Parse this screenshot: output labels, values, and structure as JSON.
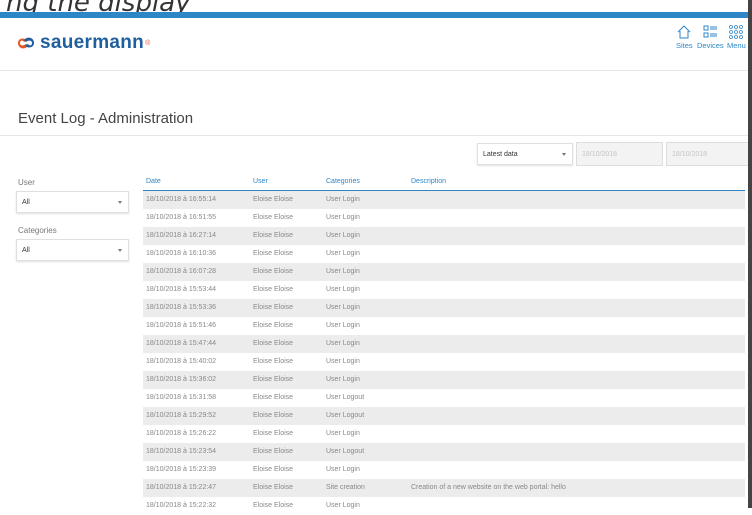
{
  "top_caption": "ng the display",
  "brand": {
    "name": "sauermann",
    "reg": "®",
    "color": "#1f5f9e",
    "accent": "#e1592b"
  },
  "nav": [
    {
      "label": "Sites",
      "icon": "home-icon"
    },
    {
      "label": "Devices",
      "icon": "list-icon"
    },
    {
      "label": "Menu",
      "icon": "grid-icon"
    }
  ],
  "page_title": "Event Log - Administration",
  "filters": {
    "period": {
      "value": "Latest data"
    },
    "date_from": {
      "value": "18/10/2018"
    },
    "date_to": {
      "value": "18/10/2018"
    },
    "user": {
      "label": "User",
      "value": "All"
    },
    "categories": {
      "label": "Categories",
      "value": "All"
    }
  },
  "table": {
    "columns": [
      "Date",
      "User",
      "Categories",
      "Description"
    ],
    "rows": [
      {
        "date": "18/10/2018 à 16:55:14",
        "user": "Eloise Eloise",
        "category": "User Login",
        "description": ""
      },
      {
        "date": "18/10/2018 à 16:51:55",
        "user": "Eloise Eloise",
        "category": "User Login",
        "description": ""
      },
      {
        "date": "18/10/2018 à 16:27:14",
        "user": "Eloise Eloise",
        "category": "User Login",
        "description": ""
      },
      {
        "date": "18/10/2018 à 16:10:36",
        "user": "Eloise Eloise",
        "category": "User Login",
        "description": ""
      },
      {
        "date": "18/10/2018 à 16:07:28",
        "user": "Eloise Eloise",
        "category": "User Login",
        "description": ""
      },
      {
        "date": "18/10/2018 à 15:53:44",
        "user": "Eloise Eloise",
        "category": "User Login",
        "description": ""
      },
      {
        "date": "18/10/2018 à 15:53:36",
        "user": "Eloise Eloise",
        "category": "User Login",
        "description": ""
      },
      {
        "date": "18/10/2018 à 15:51:46",
        "user": "Eloise Eloise",
        "category": "User Login",
        "description": ""
      },
      {
        "date": "18/10/2018 à 15:47:44",
        "user": "Eloise Eloise",
        "category": "User Login",
        "description": ""
      },
      {
        "date": "18/10/2018 à 15:40:02",
        "user": "Eloise Eloise",
        "category": "User Login",
        "description": ""
      },
      {
        "date": "18/10/2018 à 15:36:02",
        "user": "Eloise Eloise",
        "category": "User Login",
        "description": ""
      },
      {
        "date": "18/10/2018 à 15:31:58",
        "user": "Eloise Eloise",
        "category": "User Logout",
        "description": ""
      },
      {
        "date": "18/10/2018 à 15:29:52",
        "user": "Eloise Eloise",
        "category": "User Logout",
        "description": ""
      },
      {
        "date": "18/10/2018 à 15:26:22",
        "user": "Eloise Eloise",
        "category": "User Login",
        "description": ""
      },
      {
        "date": "18/10/2018 à 15:23:54",
        "user": "Eloise Eloise",
        "category": "User Logout",
        "description": ""
      },
      {
        "date": "18/10/2018 à 15:23:39",
        "user": "Eloise Eloise",
        "category": "User Login",
        "description": ""
      },
      {
        "date": "18/10/2018 à 15:22:47",
        "user": "Eloise Eloise",
        "category": "Site creation",
        "description": "Creation of a new website on the web portal: hello"
      },
      {
        "date": "18/10/2018 à 15:22:32",
        "user": "Eloise Eloise",
        "category": "User Login",
        "description": ""
      }
    ]
  },
  "colors": {
    "accent": "#2f86c7",
    "row_alt": "#ececec",
    "header_text": "#2f86c7"
  }
}
